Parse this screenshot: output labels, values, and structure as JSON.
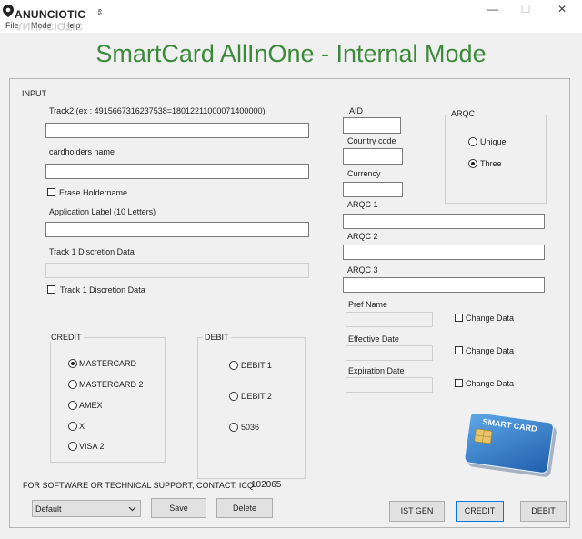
{
  "window": {
    "min_glyph": "—",
    "max_glyph": "☐",
    "close_glyph": "✕"
  },
  "logo": {
    "text": "ANUNCIOTIC",
    "suffix": "es"
  },
  "menu": {
    "file": "File",
    "mode": "Mode",
    "help": "Help"
  },
  "app_title": "SmartCard AllInOne - Internal Mode",
  "input_group": {
    "legend": "INPUT",
    "track2_label": "Track2 (ex : 4915667316237538=18012211000071400000)",
    "track2_value": "",
    "cardholder_label": "cardholders name",
    "cardholder_value": "",
    "erase_holdername_label": "Erase Holdername",
    "app_label_label": "Application Label (10 Letters)",
    "app_label_value": "",
    "track1_disc_label": "Track 1 Discretion Data",
    "track1_disc_check_label": "Track 1 Discretion Data"
  },
  "right_fields": {
    "aid_label": "AID",
    "country_code_label": "Country code",
    "currency_label": "Currency",
    "arqc1_label": "ARQC 1",
    "arqc2_label": "ARQC 2",
    "arqc3_label": "ARQC 3",
    "pref_name_label": "Pref Name",
    "effective_date_label": "Effective Date",
    "expiration_date_label": "Expiration Date",
    "change_data_label": "Change Data"
  },
  "arqc_group": {
    "legend": "ARQC",
    "options": [
      "Unique",
      "Three"
    ],
    "selected": "Three"
  },
  "credit_group": {
    "legend": "CREDIT",
    "options": [
      "MASTERCARD",
      "MASTERCARD 2",
      "AMEX",
      "X",
      "VISA 2"
    ],
    "selected": "MASTERCARD"
  },
  "debit_group": {
    "legend": "DEBIT",
    "options": [
      "DEBIT 1",
      "DEBIT 2",
      "5036"
    ]
  },
  "card_image": {
    "text": "SMART CARD"
  },
  "support": {
    "text": "FOR SOFTWARE OR TECHNICAL SUPPORT, CONTACT: ICQ",
    "icq": "102065"
  },
  "bottom": {
    "preset_value": "Default",
    "save_label": "Save",
    "delete_label": "Delete",
    "ist_gen_label": "IST GEN",
    "credit_label": "CREDIT",
    "debit_label": "DEBIT"
  }
}
